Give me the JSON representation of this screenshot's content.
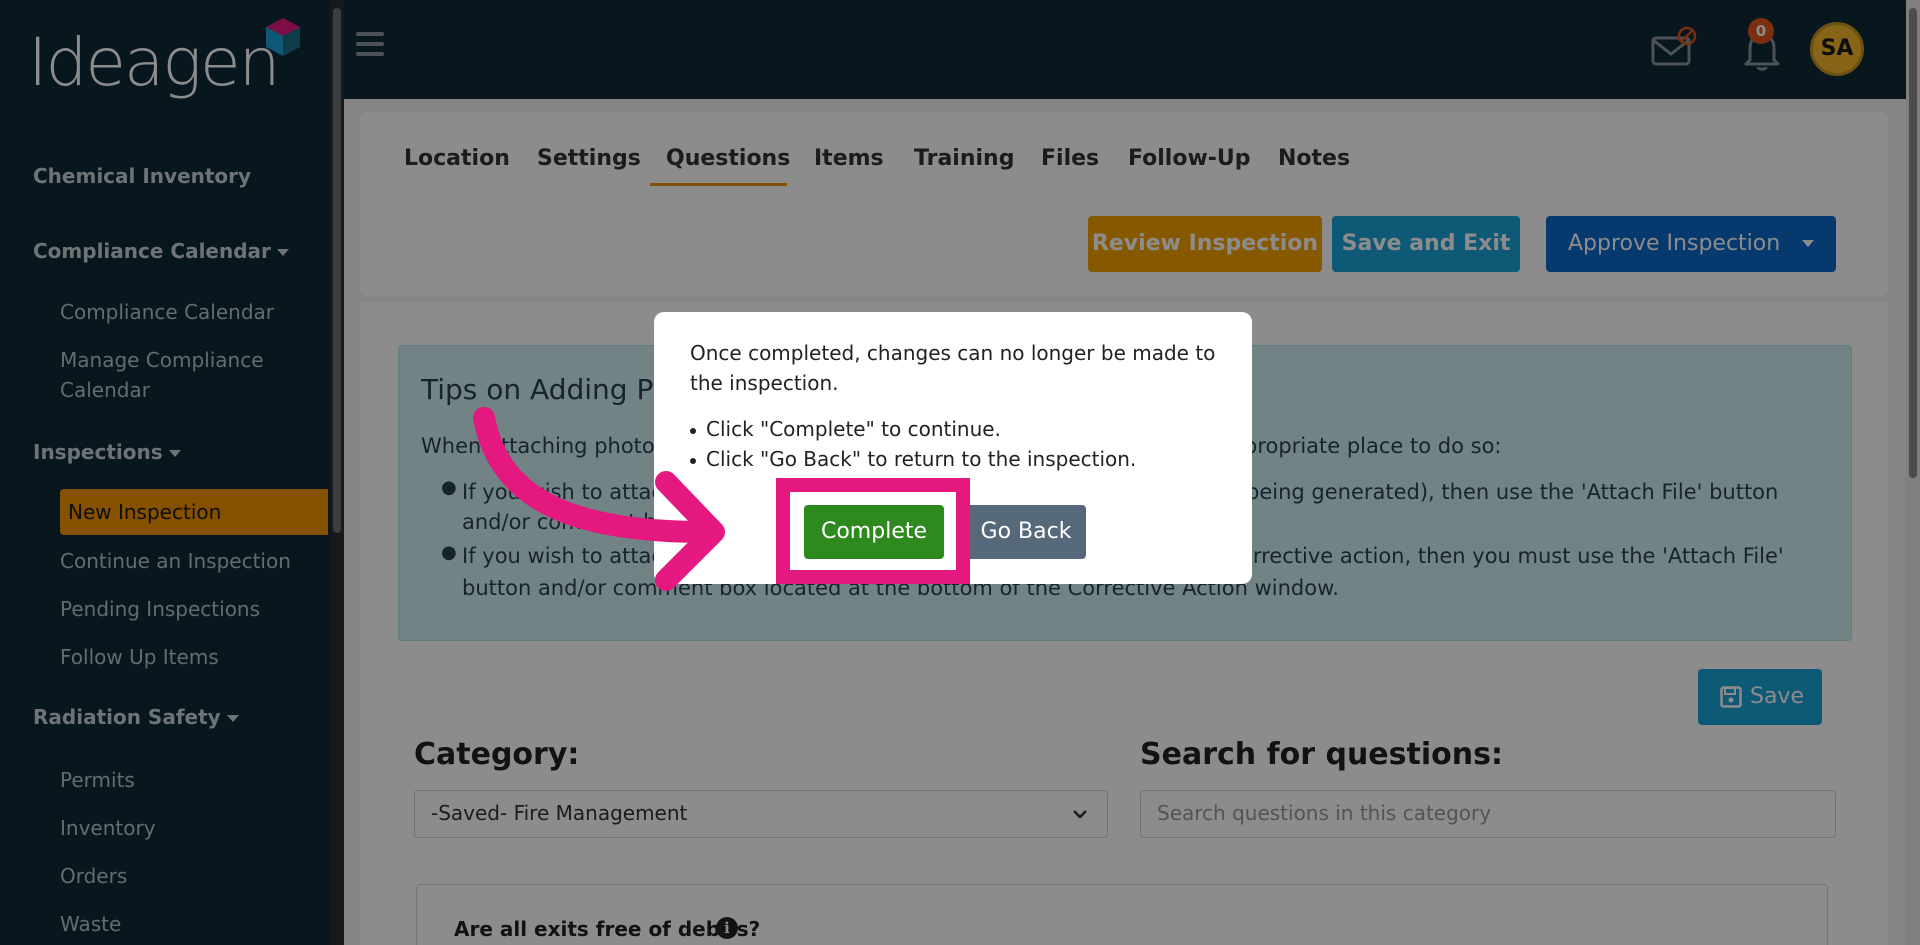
{
  "logo": {
    "text": "Ideagen"
  },
  "sidebar": {
    "sections": [
      {
        "label": "Chemical Inventory"
      },
      {
        "label": "Compliance Calendar"
      },
      {
        "label": "Inspections"
      },
      {
        "label": "Radiation Safety"
      }
    ],
    "items": [
      {
        "label": "Compliance Calendar"
      },
      {
        "label": "Manage Compliance"
      },
      {
        "label": "Calendar"
      },
      {
        "label": "New Inspection"
      },
      {
        "label": "Continue an Inspection"
      },
      {
        "label": "Pending Inspections"
      },
      {
        "label": "Follow Up Items"
      },
      {
        "label": "Permits"
      },
      {
        "label": "Inventory"
      },
      {
        "label": "Orders"
      },
      {
        "label": "Waste"
      }
    ]
  },
  "topbar": {
    "notifications_count": "0",
    "avatar_initials": "SA"
  },
  "tabs": [
    {
      "label": "Location"
    },
    {
      "label": "Settings"
    },
    {
      "label": "Questions"
    },
    {
      "label": "Items"
    },
    {
      "label": "Training"
    },
    {
      "label": "Files"
    },
    {
      "label": "Follow-Up"
    },
    {
      "label": "Notes"
    }
  ],
  "actions": {
    "review": "Review Inspection",
    "save_exit": "Save and Exit",
    "approve": "Approve Inspection",
    "save": "Save"
  },
  "tips": {
    "title": "Tips on Adding Ph",
    "intro_left": "When attaching photo",
    "intro_right": "propriate place to do so:",
    "b1_left": "If you wish to attac",
    "b1_right": "being generated), then use the 'Attach File' button",
    "b1_line2": "and/or comment b",
    "b2_left": "If you wish to attac",
    "b2_right": "orrective action, then you must use the 'Attach File'",
    "b2_line2": "button and/or comment box located at the bottom of the Corrective Action window."
  },
  "category": {
    "label": "Category:",
    "selected": "-Saved- Fire Management"
  },
  "search": {
    "label": "Search for questions:",
    "placeholder": "Search questions in this category"
  },
  "question": {
    "text": "Are all exits free of debris?"
  },
  "modal": {
    "message": "Once completed, changes can no longer be made to the inspection.",
    "bullet1": "Click \"Complete\" to continue.",
    "bullet2": "Click \"Go Back\" to return to the inspection.",
    "complete": "Complete",
    "go_back": "Go Back"
  },
  "colors": {
    "sidebar_bg": "#0f2a38",
    "accent_orange": "#f39200",
    "highlight_pink": "#e4197f",
    "complete_green": "#2e8a1e"
  }
}
